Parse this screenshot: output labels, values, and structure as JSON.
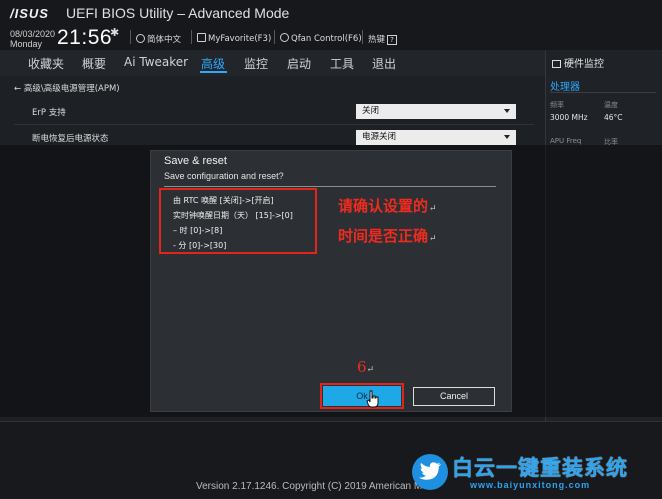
{
  "header": {
    "logo": "/ISUS",
    "title": "UEFI BIOS Utility – Advanced Mode",
    "date": "08/03/2020",
    "weekday": "Monday",
    "time": "21:56",
    "language": "简体中文",
    "myfavorite": "MyFavorite(F3)",
    "qfan": "Qfan Control(F6)",
    "hotkeys": "热键",
    "help_glyph": "?"
  },
  "tabs": [
    {
      "label": "收藏夹"
    },
    {
      "label": "概要"
    },
    {
      "label": "Ai Tweaker"
    },
    {
      "label": "高级",
      "active": true
    },
    {
      "label": "监控"
    },
    {
      "label": "启动"
    },
    {
      "label": "工具"
    },
    {
      "label": "退出"
    }
  ],
  "breadcrumb": "高级\\高级电源管理(APM)",
  "settings": [
    {
      "label": "ErP 支持",
      "value": "关闭"
    },
    {
      "label": "断电恢复后电源状态",
      "value": "电源关闭"
    }
  ],
  "hardware_monitor": {
    "title": "硬件监控",
    "section": "处理器",
    "freq_label": "频率",
    "freq_value": "3000 MHz",
    "temp_label": "温度",
    "temp_value": "46°C",
    "apu_label": "APU Freq",
    "ratio_label": "比率"
  },
  "dialog": {
    "title": "Save & reset",
    "subtitle": "Save configuration and reset?",
    "changes": [
      "由 RTC 唤醒 [关闭]->[开启]",
      "实时钟唤醒日期（天） [15]->[0]",
      "– 时 [0]->[8]",
      "- 分 [0]->[30]"
    ],
    "ok_label": "Ok",
    "cancel_label": "Cancel"
  },
  "annotations": {
    "note_line1": "请确认设置的",
    "note_line2": "时间是否正确",
    "step_number": "6",
    "return_mark": "↵",
    "color": "#ef2b20"
  },
  "footer": {
    "version": "Version 2.17.1246. Copyright (C) 2019 American Me"
  },
  "watermark": {
    "text": "白云一键重装系统",
    "url": "www.baiyunxitong.com"
  },
  "colors": {
    "accent": "#2fa9ff",
    "ok_button": "#1fa8e8",
    "highlight_box": "#e1251b"
  }
}
